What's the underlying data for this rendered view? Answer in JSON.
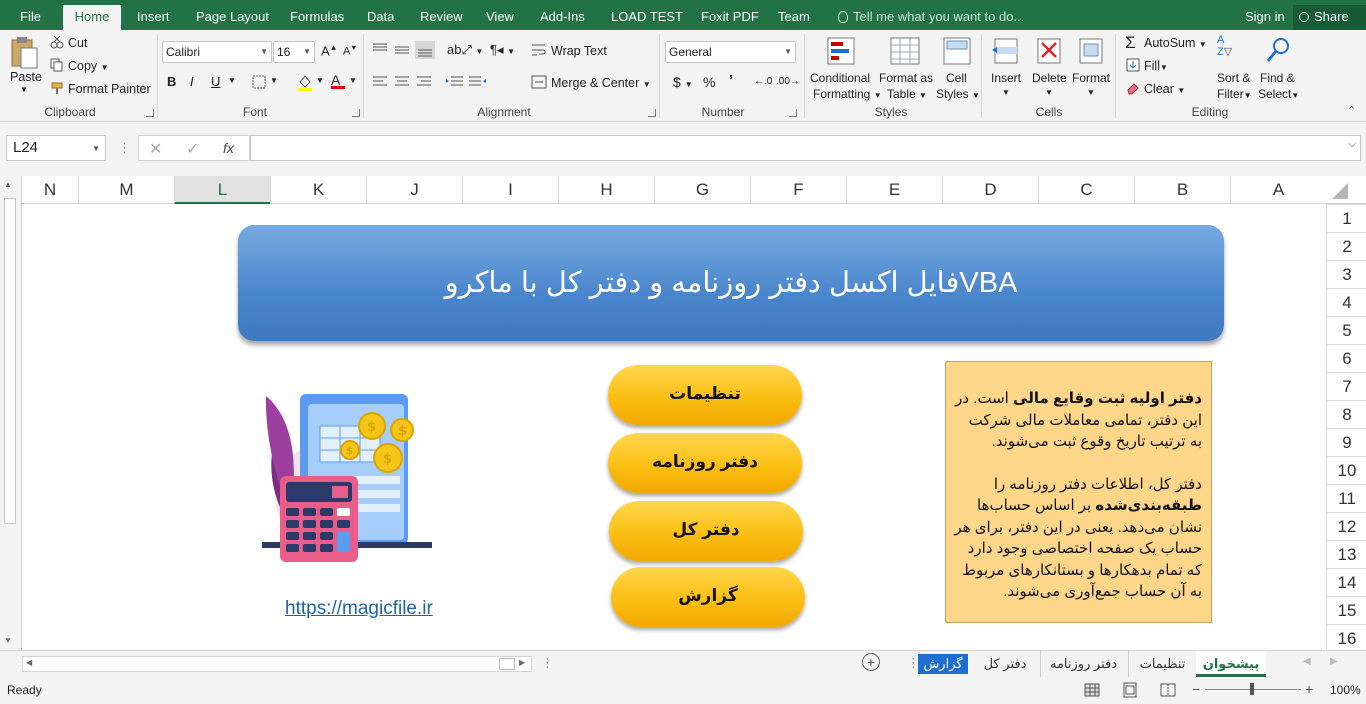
{
  "tabs": {
    "file": "File",
    "home": "Home",
    "insert": "Insert",
    "page_layout": "Page Layout",
    "formulas": "Formulas",
    "data": "Data",
    "review": "Review",
    "view": "View",
    "addins": "Add-Ins",
    "load_test": "LOAD TEST",
    "foxit": "Foxit PDF",
    "team": "Team",
    "tell_me": "Tell me what you want to do...",
    "sign_in": "Sign in",
    "share": "Share"
  },
  "ribbon": {
    "clipboard": {
      "paste": "Paste",
      "cut": "Cut",
      "copy": "Copy",
      "format_painter": "Format Painter",
      "label": "Clipboard"
    },
    "font": {
      "name": "Calibri",
      "size": "16",
      "bold": "B",
      "italic": "I",
      "underline": "U",
      "label": "Font"
    },
    "alignment": {
      "wrap_text": "Wrap Text",
      "merge_center": "Merge & Center",
      "label": "Alignment"
    },
    "number": {
      "format": "General",
      "currency": "$",
      "percent": "%",
      "comma": "’",
      "label": "Number"
    },
    "styles": {
      "conditional_l1": "Conditional",
      "conditional_l2": "Formatting",
      "format_table_l1": "Format as",
      "format_table_l2": "Table",
      "cell_styles_l1": "Cell",
      "cell_styles_l2": "Styles",
      "label": "Styles"
    },
    "cells": {
      "insert": "Insert",
      "delete": "Delete",
      "format": "Format",
      "label": "Cells"
    },
    "editing": {
      "autosum": "AutoSum",
      "fill": "Fill",
      "clear": "Clear",
      "sort_l1": "Sort &",
      "sort_l2": "Filter",
      "find_l1": "Find &",
      "find_l2": "Select",
      "label": "Editing"
    }
  },
  "formula_bar": {
    "name_box": "L24",
    "fx": "fx",
    "value": ""
  },
  "columns": [
    "N",
    "M",
    "L",
    "K",
    "J",
    "I",
    "H",
    "G",
    "F",
    "E",
    "D",
    "C",
    "B",
    "A"
  ],
  "selected_column": "L",
  "rows": [
    "1",
    "2",
    "3",
    "4",
    "5",
    "6",
    "7",
    "8",
    "9",
    "10",
    "11",
    "12",
    "13",
    "14",
    "15",
    "16"
  ],
  "sheet": {
    "banner_title": "فایل اکسل دفتر روزنامه و دفتر کل با ماکروVBA",
    "buttons": [
      "تنظیمات",
      "دفتر روزنامه",
      "دفتر کل",
      "گزارش"
    ],
    "info": {
      "p1_bold": "دفتر اولیه ثبت وقایع مالی",
      "p1_rest": " است. در این دفتر، تمامی معاملات مالی شرکت به ترتیب تاریخ وقوع ثبت می‌شوند.",
      "p2_a": "دفتر کل، اطلاعات دفتر روزنامه را ",
      "p2_bold": "طبقه‌بندی‌شده",
      "p2_b": " بر اساس حساب‌ها نشان می‌دهد. یعنی در این دفتر، برای هر حساب یک صفحه اختصاصی وجود دارد که تمام بدهکارها و بستانکارهای مربوط به آن حساب جمع‌آوری می‌شوند."
    },
    "link": "https://magicfile.ir"
  },
  "sheet_tabs": [
    "پیشخوان",
    "تنظیمات",
    "دفتر روزنامه",
    "دفتر کل",
    "گزارش"
  ],
  "active_sheet": "پیشخوان",
  "status": {
    "ready": "Ready",
    "zoom": "100%"
  },
  "colors": {
    "excel_green": "#217346",
    "banner_blue": "#4a86cc",
    "button_gold": "#fbbf14",
    "info_bg": "#fdd68a"
  }
}
